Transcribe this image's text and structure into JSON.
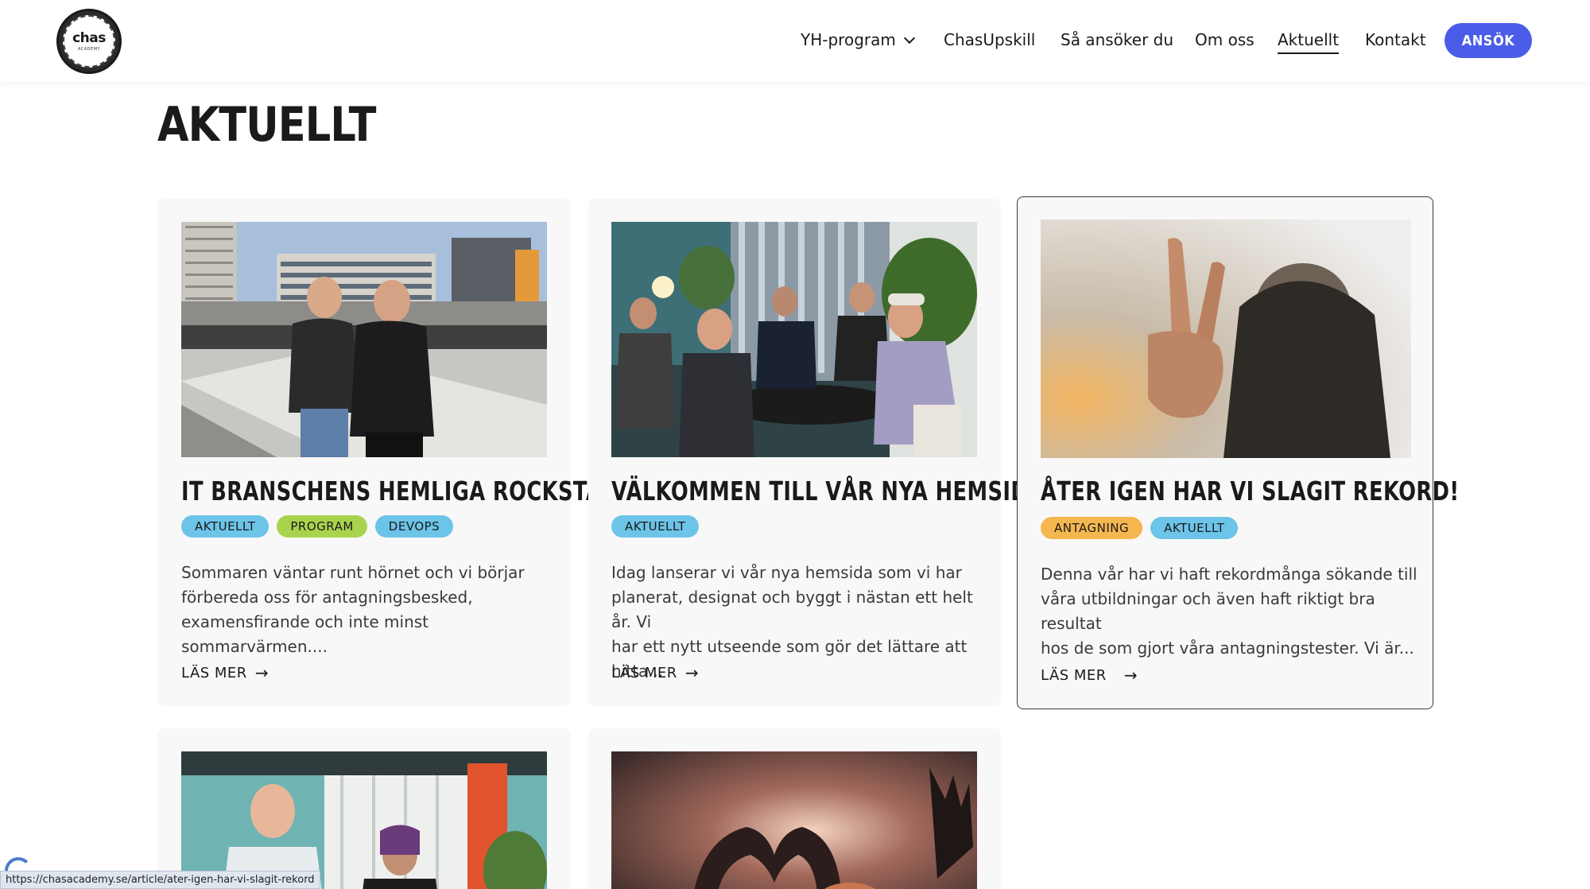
{
  "header": {
    "logo_text": "chas",
    "logo_sub": "ACADEMY",
    "nav": [
      {
        "label": "YH-program",
        "has_dropdown": true
      },
      {
        "label": "ChasUpskill"
      },
      {
        "label": "Så ansöker du"
      },
      {
        "label": "Om oss"
      },
      {
        "label": "Aktuellt",
        "active": true
      },
      {
        "label": "Kontakt"
      }
    ],
    "cta_label": "ANSÖK",
    "cta_color": "#4a5de8"
  },
  "page": {
    "title": "AKTUELLT"
  },
  "articles": [
    {
      "title": "IT BRANSCHENS HEMLIGA ROCKSTARS",
      "tags": [
        {
          "label": "AKTUELLT",
          "color": "#6cc4e8"
        },
        {
          "label": "PROGRAM",
          "color": "#a9d34d"
        },
        {
          "label": "DEVOPS",
          "color": "#6cc4e8"
        }
      ],
      "excerpt_lines": [
        "Sommaren väntar runt hörnet och vi börjar",
        "förbereda oss för antagningsbesked,",
        "examensfirande och inte minst sommarvärmen...."
      ],
      "read_more": "LÄS MER"
    },
    {
      "title": "VÄLKOMMEN TILL VÅR NYA HEMSIDA!",
      "tags": [
        {
          "label": "AKTUELLT",
          "color": "#6cc4e8"
        }
      ],
      "excerpt_lines": [
        "Idag lanserar vi vår nya hemsida som vi har",
        "planerat, designat och byggt i nästan ett helt år. Vi",
        "har ett nytt utseende som gör det lättare att hitta..."
      ],
      "read_more": "LÄS MER"
    },
    {
      "title": "ÅTER IGEN HAR VI SLAGIT REKORD!",
      "tags": [
        {
          "label": "ANTAGNING",
          "color": "#f4b64f"
        },
        {
          "label": "AKTUELLT",
          "color": "#6cc4e8"
        }
      ],
      "excerpt_lines": [
        "Denna vår har vi haft rekordmånga sökande till",
        "våra utbildningar och även haft riktigt bra resultat",
        "hos de som gjort våra antagningstester. Vi är..."
      ],
      "read_more": "LÄS MER"
    }
  ],
  "status_bar": {
    "url": "https://chasacademy.se/article/ater-igen-har-vi-slagit-rekord"
  }
}
